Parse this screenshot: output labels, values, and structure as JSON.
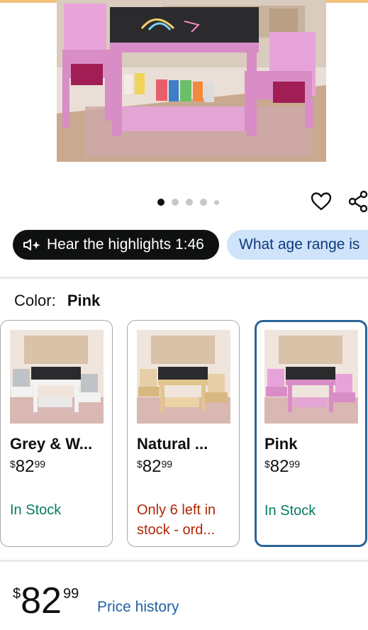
{
  "gallery": {
    "image_count": 5,
    "active_index": 0
  },
  "actions": {
    "wishlist_icon": "heart-icon",
    "share_icon": "share-icon"
  },
  "chips": {
    "highlights_label": "Hear the highlights 1:46",
    "question_label": "What age range is"
  },
  "color": {
    "label": "Color:",
    "selected": "Pink"
  },
  "variants": [
    {
      "name": "Grey & W...",
      "price_symbol": "$",
      "price_whole": "82",
      "price_cents": "99",
      "stock_line1": "In Stock",
      "stock_line2": "",
      "stock_color": "#067d62",
      "selected": false
    },
    {
      "name": "Natural ...",
      "price_symbol": "$",
      "price_whole": "82",
      "price_cents": "99",
      "stock_line1": "Only 6 left in",
      "stock_line2": "stock - ord...",
      "stock_color": "#b12704",
      "selected": false
    },
    {
      "name": "Pink",
      "price_symbol": "$",
      "price_whole": "82",
      "price_cents": "99",
      "stock_line1": "In Stock",
      "stock_line2": "",
      "stock_color": "#067d62",
      "selected": true
    }
  ],
  "buybox": {
    "price_symbol": "$",
    "price_whole": "82",
    "price_cents": "99",
    "price_history_label": "Price history"
  },
  "colors": {
    "selected_border": "#2c6497",
    "link": "#2162a1",
    "in_stock": "#067d62",
    "low_stock": "#b12704",
    "chip_light_bg": "#cfe3fb"
  }
}
